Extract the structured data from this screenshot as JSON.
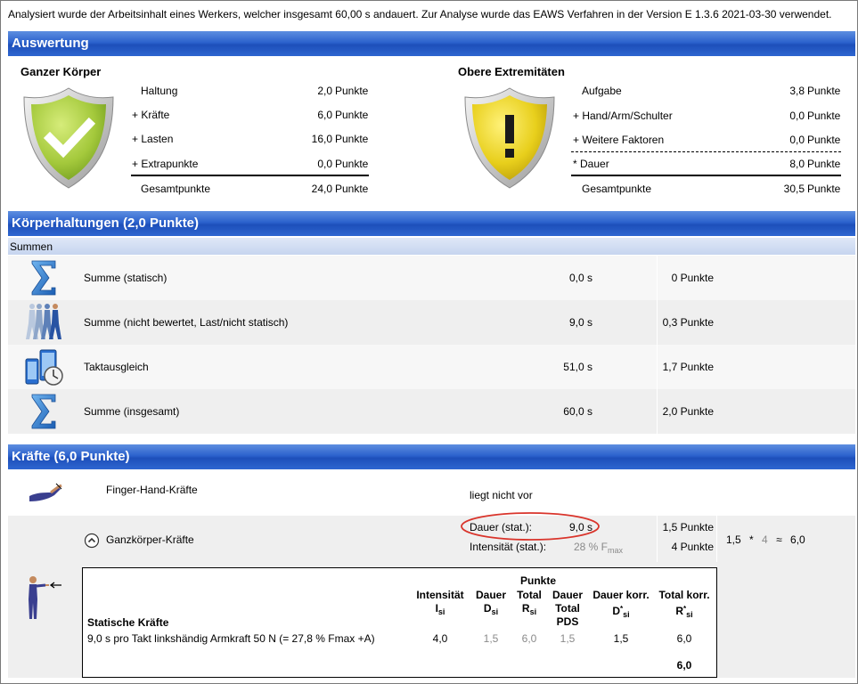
{
  "intro": "Analysiert wurde der Arbeitsinhalt eines Werkers, welcher insgesamt 60,00 s andauert. Zur Analyse wurde das EAWS Verfahren in der Version E 1.3.6 2021-03-30 verwendet.",
  "auswertung": {
    "title": "Auswertung",
    "ganzer_koerper": {
      "heading": "Ganzer Körper",
      "rows": [
        {
          "label": "Haltung",
          "value": "2,0",
          "unit": "Punkte"
        },
        {
          "label": "+ Kräfte",
          "value": "6,0",
          "unit": "Punkte"
        },
        {
          "label": "+ Lasten",
          "value": "16,0",
          "unit": "Punkte"
        },
        {
          "label": "+ Extrapunkte",
          "value": "0,0",
          "unit": "Punkte"
        }
      ],
      "total_label": "Gesamtpunkte",
      "total_value": "24,0",
      "total_unit": "Punkte",
      "status": "green"
    },
    "obere_extremitaeten": {
      "heading": "Obere Extremitäten",
      "rows": [
        {
          "label": "Aufgabe",
          "value": "3,8",
          "unit": "Punkte"
        },
        {
          "label": "+ Hand/Arm/Schulter",
          "value": "0,0",
          "unit": "Punkte"
        },
        {
          "label": "+ Weitere Faktoren",
          "value": "0,0",
          "unit": "Punkte"
        },
        {
          "label": "* Dauer",
          "value": "8,0",
          "unit": "Punkte"
        }
      ],
      "total_label": "Gesamtpunkte",
      "total_value": "30,5",
      "total_unit": "Punkte",
      "status": "yellow"
    }
  },
  "koerperhaltungen": {
    "title": "Körperhaltungen (2,0 Punkte)",
    "summen_label": "Summen",
    "rows": [
      {
        "icon": "sigma-icon",
        "label": "Summe (statisch)",
        "duration": "0,0 s",
        "points": "0 Punkte"
      },
      {
        "icon": "walking-workers-icon",
        "label": "Summe (nicht bewertet, Last/nicht statisch)",
        "duration": "9,0 s",
        "points": "0,3 Punkte"
      },
      {
        "icon": "cycle-clock-icon",
        "label": "Taktausgleich",
        "duration": "51,0 s",
        "points": "1,7 Punkte"
      },
      {
        "icon": "sigma-icon",
        "label": "Summe (insgesamt)",
        "duration": "60,0 s",
        "points": "2,0 Punkte"
      }
    ]
  },
  "kraefte": {
    "title": "Kräfte (6,0 Punkte)",
    "finger_hand": {
      "label": "Finger-Hand-Kräfte",
      "status": "liegt nicht vor"
    },
    "ganzkoerper": {
      "label": "Ganzkörper-Kräfte",
      "dauer_label": "Dauer (stat.):",
      "dauer_value": "9,0 s",
      "intensitaet_label": "Intensität (stat.):",
      "intensitaet_value": "28 % F",
      "intensitaet_sub": "max",
      "dauer_points": "1,5 Punkte",
      "intensitaet_points": "4 Punkte",
      "formula_a": "1,5",
      "formula_op": "*",
      "formula_b": "4",
      "formula_approx": "≈",
      "formula_result": "6,0"
    },
    "statische": {
      "punkte_header": "Punkte",
      "col_intensitaet": "Intensität",
      "col_intensitaet_sym": "I",
      "col_dauer": "Dauer",
      "col_dauer_sym": "D",
      "col_total": "Total",
      "col_total_sym": "R",
      "col_dauer_total": "Dauer",
      "col_dauer_total_2": "Total",
      "col_dauer_total_3": "PDS",
      "col_dauer_korr": "Dauer korr.",
      "col_dauer_korr_sym": "D",
      "col_total_korr": "Total korr.",
      "col_total_korr_sym": "R",
      "sub_si": "si",
      "section_label": "Statische Kräfte",
      "row_label": "9,0 s pro Takt linkshändig Armkraft  50 N (= 27,8 % Fmax +A)",
      "row_values": {
        "intensitaet": "4,0",
        "dauer": "1,5",
        "total": "6,0",
        "pds": "1,5",
        "dauer_korr": "1,5",
        "total_korr": "6,0"
      },
      "sum": "6,0"
    }
  },
  "colors": {
    "accent_bar": "#2c62cd",
    "highlight_circle": "#d9342b",
    "shield_green": "#9cc53a",
    "shield_yellow": "#e3c61b"
  }
}
